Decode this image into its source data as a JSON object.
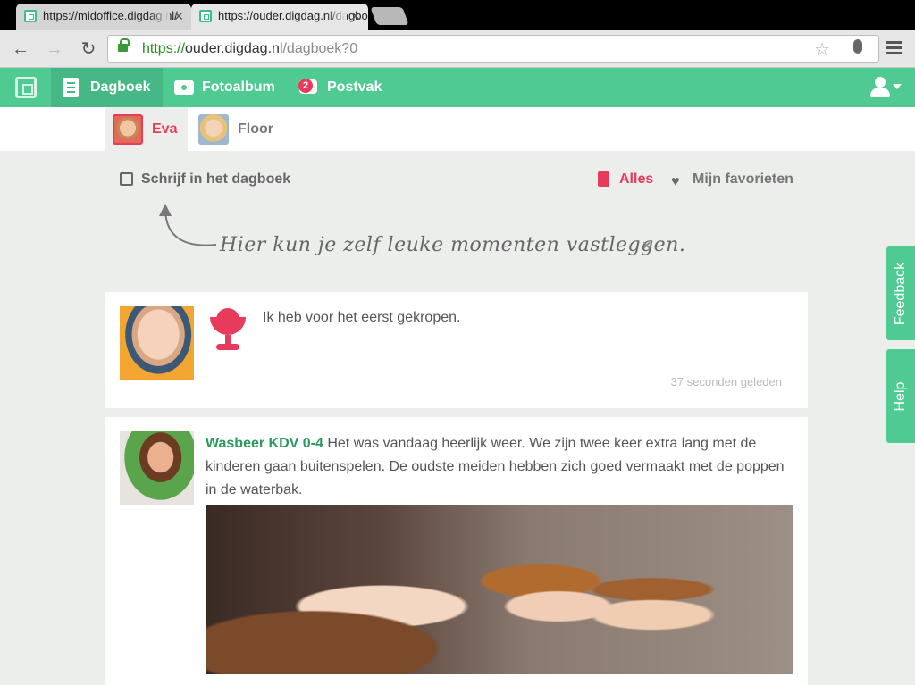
{
  "browser": {
    "tabs": [
      {
        "title": "https://midoffice.digdag.nl/",
        "active": false
      },
      {
        "title": "https://ouder.digdag.nl/dagboek",
        "active": true
      }
    ],
    "url": {
      "scheme": "https://",
      "host": "ouder.digdag.nl",
      "path": "/dagboek?0"
    }
  },
  "nav": {
    "items": [
      {
        "label": "Dagboek",
        "icon": "diary-icon"
      },
      {
        "label": "Fotoalbum",
        "icon": "camera-icon"
      },
      {
        "label": "Postvak",
        "icon": "chat-icon",
        "badge": "2"
      }
    ]
  },
  "children": [
    {
      "name": "Eva",
      "active": true
    },
    {
      "name": "Floor",
      "active": false
    }
  ],
  "actions": {
    "write": "Schrijf in het dagboek",
    "filter_all": "Alles",
    "filter_fav": "Mijn favorieten"
  },
  "hint": {
    "text": "Hier kun je zelf leuke momenten vastleggen.",
    "close": "×"
  },
  "posts": [
    {
      "text": "Ik heb voor het eerst gekropen.",
      "time": "37 seconden geleden"
    },
    {
      "author": "Wasbeer KDV 0-4",
      "text": " Het was vandaag heerlijk weer. We zijn twee keer extra lang met de kinderen gaan buitenspelen. De oudste meiden hebben zich goed vermaakt met de poppen in de waterbak."
    }
  ],
  "side": {
    "feedback": "Feedback",
    "help": "Help"
  },
  "colors": {
    "brand": "#4fca93",
    "accent": "#e83a5a"
  }
}
